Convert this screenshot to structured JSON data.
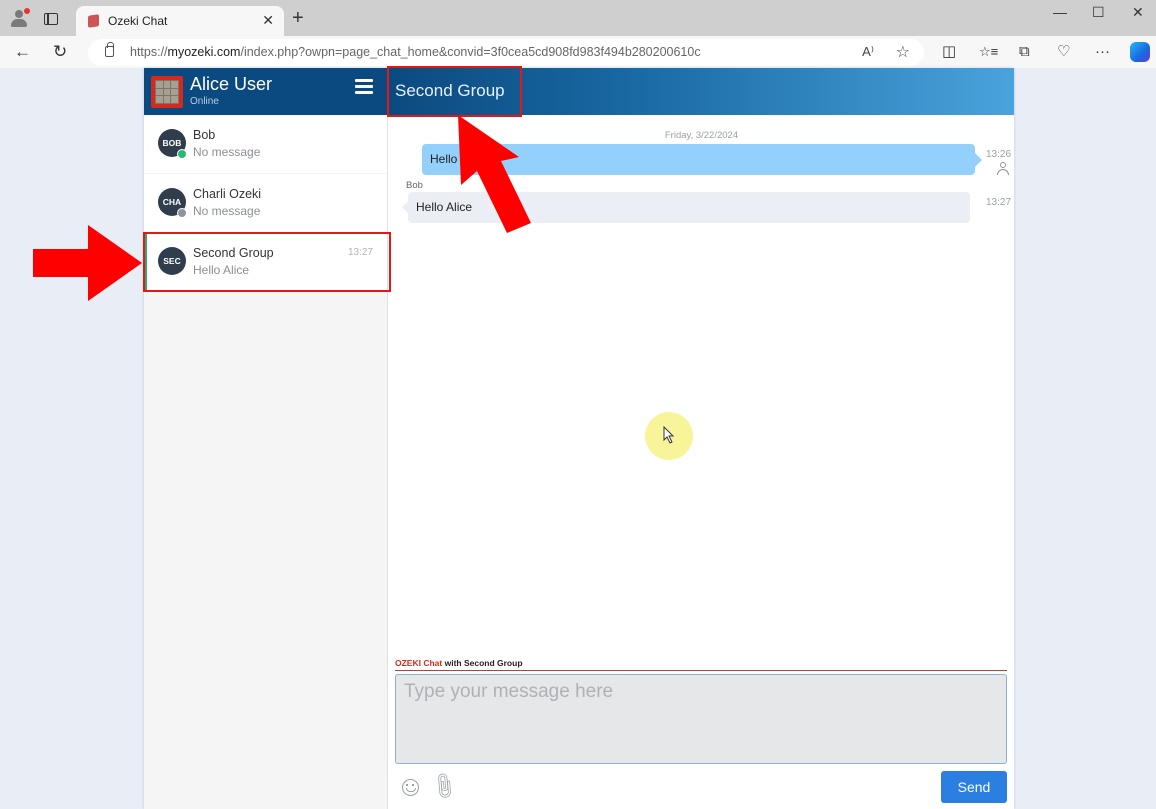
{
  "browser": {
    "tab_title": "Ozeki Chat",
    "url_prefix": "https://",
    "url_domain": "myozeki.com",
    "url_path": "/index.php?owpn=page_chat_home&convid=3f0cea5cd908fd983f494b280200610c",
    "window_controls": {
      "minimize": "—",
      "maximize": "☐",
      "close": "✕"
    },
    "icons": {
      "back": "←",
      "refresh": "↻",
      "read_aloud": "A⁾",
      "favorite": "☆",
      "split_screen": "◫",
      "favorites": "☆≡",
      "collections": "⧉",
      "health": "♡",
      "more": "···"
    }
  },
  "sidebar": {
    "user_name": "Alice User",
    "user_status": "Online",
    "contacts": [
      {
        "initials": "BOB",
        "name": "Bob",
        "last_message": "No message",
        "time": "",
        "presence": "online",
        "presence_color": "#2bb673"
      },
      {
        "initials": "CHA",
        "name": "Charli Ozeki",
        "last_message": "No message",
        "time": "",
        "presence": "offline",
        "presence_color": "#8d949b"
      },
      {
        "initials": "SEC",
        "name": "Second Group",
        "last_message": "Hello Alice",
        "time": "13:27",
        "active": true
      }
    ]
  },
  "chat": {
    "title": "Second Group",
    "date_separator": "Friday, 3/22/2024",
    "messages": [
      {
        "direction": "outgoing",
        "text": "Hello",
        "time": "13:26",
        "sender": ""
      },
      {
        "direction": "incoming",
        "text": "Hello Alice",
        "time": "13:27",
        "sender": "Bob"
      }
    ],
    "composer": {
      "brand": "OZEKI Chat",
      "with_label": " with Second Group",
      "placeholder": "Type your message here",
      "value": "",
      "send_label": "Send"
    }
  },
  "colors": {
    "header_blue": "#0b4a80",
    "outgoing_bubble": "#93d0fb",
    "incoming_bubble": "#ebeff5",
    "send_button": "#2a7fe0",
    "annotation_red": "#e01818"
  }
}
